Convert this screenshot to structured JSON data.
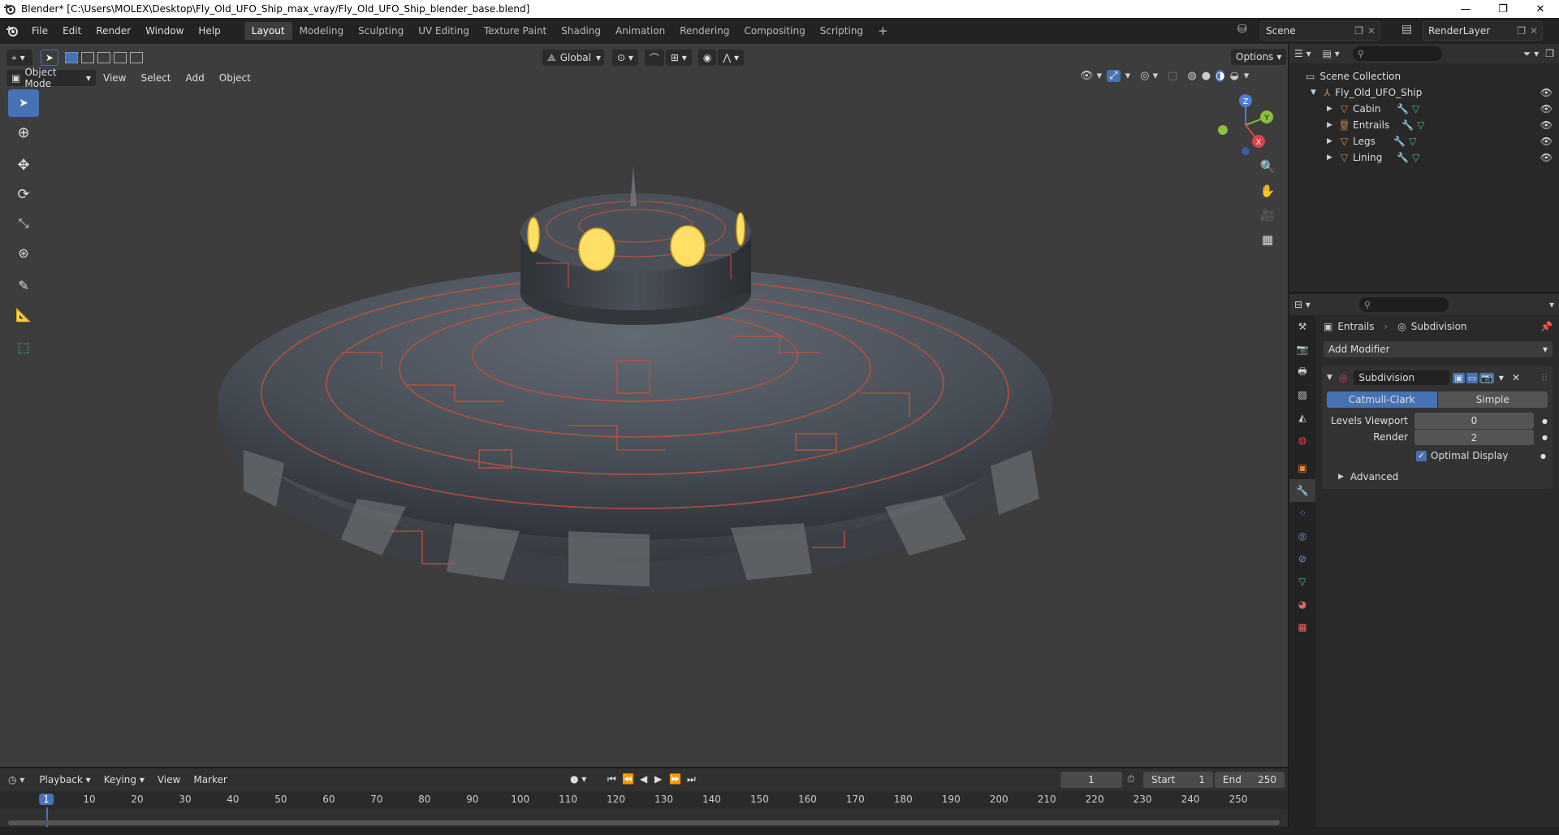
{
  "window": {
    "title": "Blender* [C:\\Users\\MOLEX\\Desktop\\Fly_Old_UFO_Ship_max_vray/Fly_Old_UFO_Ship_blender_base.blend]",
    "controls": [
      "—",
      "❐",
      "✕"
    ]
  },
  "menu": [
    "File",
    "Edit",
    "Render",
    "Window",
    "Help"
  ],
  "workspaces": [
    "Layout",
    "Modeling",
    "Sculpting",
    "UV Editing",
    "Texture Paint",
    "Shading",
    "Animation",
    "Rendering",
    "Compositing",
    "Scripting"
  ],
  "active_workspace": "Layout",
  "scene": {
    "name": "Scene",
    "render_layer": "RenderLayer"
  },
  "viewport": {
    "transform_orientation": "Global",
    "options_label": "Options",
    "mode": "Object Mode",
    "menu": [
      "View",
      "Select",
      "Add",
      "Object"
    ],
    "gizmo": {
      "x": "X",
      "y": "Y",
      "z": "Z"
    }
  },
  "outliner": {
    "root": "Scene Collection",
    "collection": "Fly_Old_UFO_Ship",
    "objects": [
      "Cabin",
      "Entrails",
      "Legs",
      "Lining"
    ]
  },
  "properties": {
    "breadcrumb_object": "Entrails",
    "breadcrumb_modifier": "Subdivision",
    "add_modifier": "Add Modifier",
    "modifier_name": "Subdivision",
    "type_options": [
      "Catmull-Clark",
      "Simple"
    ],
    "active_type": "Catmull-Clark",
    "levels_viewport_label": "Levels Viewport",
    "levels_viewport": "0",
    "render_label": "Render",
    "render": "2",
    "optimal_display_label": "Optimal Display",
    "optimal_display": true,
    "advanced_label": "Advanced"
  },
  "timeline": {
    "menu": [
      "Playback",
      "Keying",
      "View",
      "Marker"
    ],
    "current_frame": "1",
    "start_label": "Start",
    "start": "1",
    "end_label": "End",
    "end": "250",
    "ticks": [
      "1",
      "10",
      "20",
      "30",
      "40",
      "50",
      "60",
      "70",
      "80",
      "90",
      "100",
      "110",
      "120",
      "130",
      "140",
      "150",
      "160",
      "170",
      "180",
      "190",
      "200",
      "210",
      "220",
      "230",
      "240",
      "250"
    ]
  },
  "colors": {
    "accent": "#4772b3",
    "object_orange": "#e8893a",
    "mesh_green": "#3cc48a",
    "window_light": "#ffe066",
    "trim_red": "#c4503a"
  }
}
